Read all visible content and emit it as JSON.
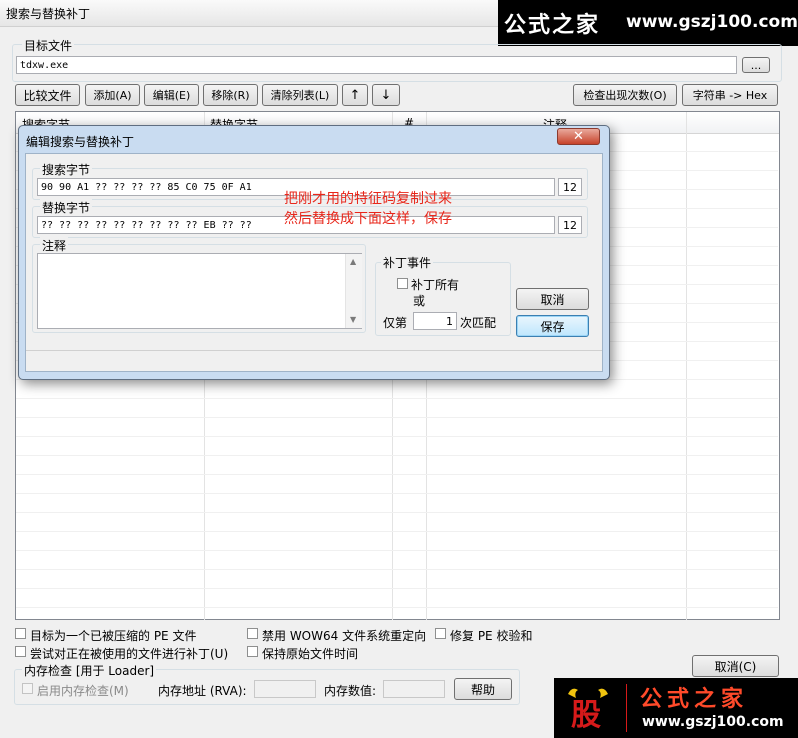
{
  "window": {
    "title": "搜索与替换补丁"
  },
  "watermark_top": {
    "brand": "公式之家",
    "url": "www.gszj100.com"
  },
  "watermark_bottom": {
    "logo_char": "股",
    "brand": "公式之家",
    "url": "www.gszj100.com"
  },
  "target": {
    "label": "目标文件",
    "value": "tdxw.exe",
    "browse_label": "..."
  },
  "toolbar": {
    "compare": "比较文件",
    "add": "添加(A)",
    "edit": "编辑(E)",
    "remove": "移除(R)",
    "clear": "清除列表(L)",
    "up": "↑",
    "down": "↓",
    "check_count": "检查出现次数(O)",
    "string_hex": "字符串 -> Hex"
  },
  "table": {
    "columns": [
      "搜索字节",
      "替换字节",
      "#",
      "注释"
    ]
  },
  "options": {
    "packed_pe": "目标为一个已被压缩的 PE 文件",
    "disable_wow64": "禁用 WOW64 文件系统重定向",
    "fix_checksum": "修复 PE 校验和",
    "patch_in_use": "尝试对正在被使用的文件进行补丁(U)",
    "keep_time": "保持原始文件时间"
  },
  "memory": {
    "group_label": "内存检查 [用于 Loader]",
    "enable": "启用内存检查(M)",
    "address_label": "内存地址 (RVA):",
    "value_label": "内存数值:",
    "help": "帮助"
  },
  "main_cancel": "取消(C)",
  "dialog": {
    "title": "编辑搜索与替换补丁",
    "search_label": "搜索字节",
    "search_value": "90 90 A1 ?? ?? ?? ?? 85 C0 75 0F A1",
    "search_count": "12",
    "replace_label": "替换字节",
    "replace_value": "?? ?? ?? ?? ?? ?? ?? ?? ?? EB ?? ??",
    "replace_count": "12",
    "comment_label": "注释",
    "patch_event_label": "补丁事件",
    "patch_all": "补丁所有",
    "or_text": "或",
    "only_prefix": "仅第",
    "only_value": "1",
    "only_suffix": "次匹配",
    "cancel": "取消",
    "save": "保存"
  },
  "annotation": {
    "line1": "把刚才用的特征码复制过来",
    "line2": "然后替换成下面这样，保存"
  },
  "colors": {
    "annotation": "#e8261a",
    "dialog_title_bg": "#c9dcf1",
    "watermark_bg": "#000000"
  }
}
